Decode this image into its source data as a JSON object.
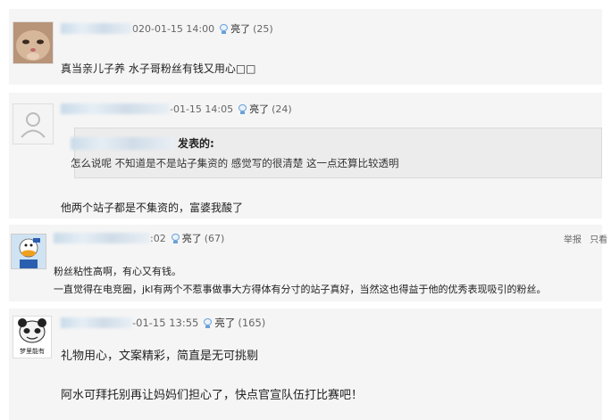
{
  "comments": [
    {
      "timestamp": "020-01-15 14:00",
      "like_label": "亮了",
      "like_count": "(25)",
      "body": "真当亲儿子养 水子哥粉丝有钱又用心□□"
    },
    {
      "timestamp": "-01-15 14:05",
      "like_label": "亮了",
      "like_count": "(24)",
      "quote_author_suffix": "发表的:",
      "quote_text": "怎么说呢 不知道是不是站子集资的 感觉写的很清楚 这一点还算比较透明",
      "body": "他两个站子都是不集资的，富婆我酸了"
    },
    {
      "timestamp": ":02",
      "like_label": "亮了",
      "like_count": "(67)",
      "report_label": "举报",
      "more_label": "只看",
      "body_line1": "粉丝粘性高啊，有心又有钱。",
      "body_line2": "一直觉得在电竞圈，jkl有两个不惹事做事大方得体有分寸的站子真好，当然这也得益于他的优秀表现吸引的粉丝。"
    },
    {
      "timestamp": "-01-15 13:55",
      "like_label": "亮了",
      "like_count": "(165)",
      "avatar_caption": "梦里能有",
      "body_line1": "礼物用心，文案精彩，简直是无可挑剔",
      "body_line2": "阿水可拜托别再让妈妈们担心了，快点官宣队伍打比赛吧！"
    }
  ]
}
